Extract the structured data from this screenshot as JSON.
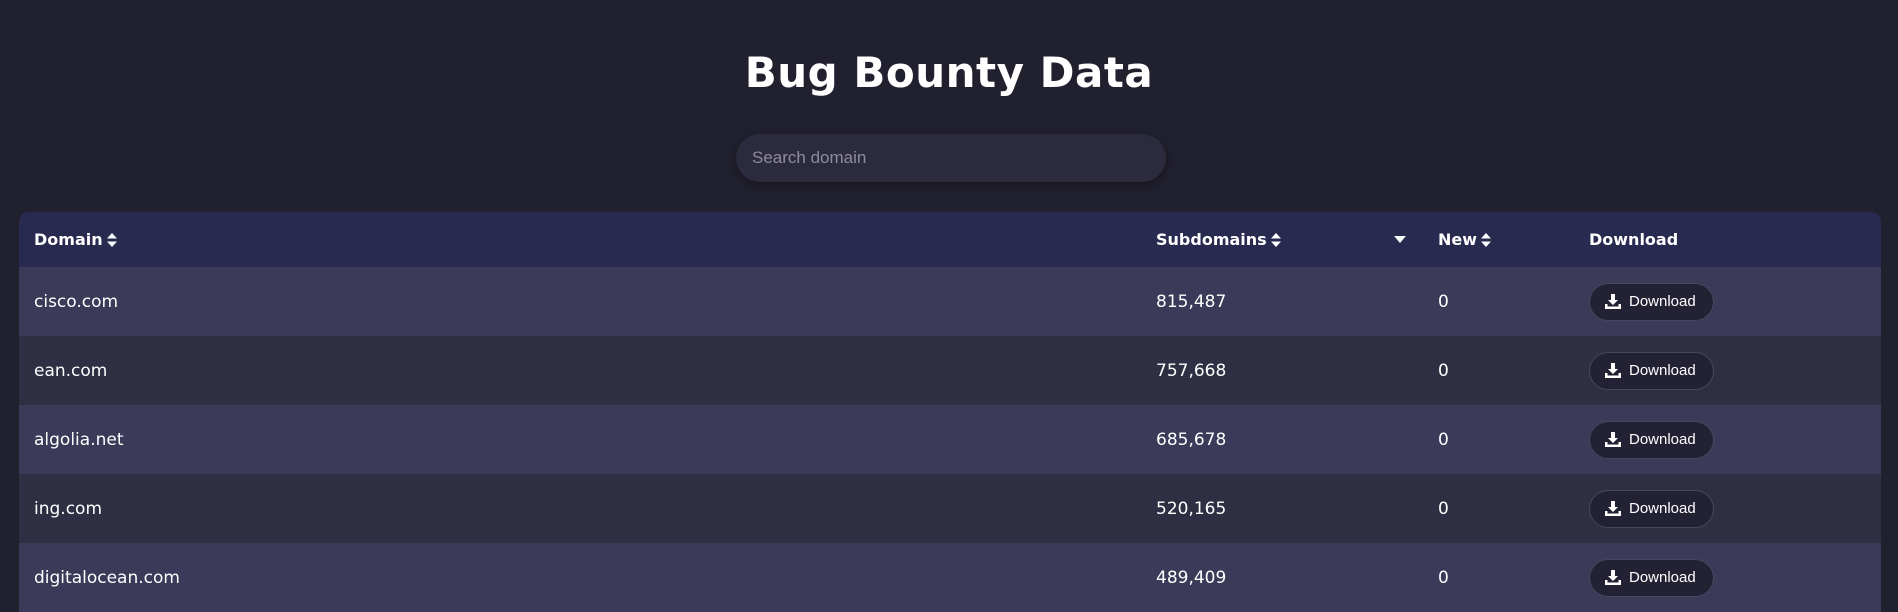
{
  "page": {
    "title": "Bug Bounty Data"
  },
  "search": {
    "placeholder": "Search domain",
    "value": ""
  },
  "table": {
    "headers": {
      "domain": "Domain",
      "subdomains": "Subdomains",
      "new": "New",
      "download": "Download"
    },
    "rows": [
      {
        "domain": "cisco.com",
        "subdomains": "815,487",
        "new": "0",
        "download_label": "Download"
      },
      {
        "domain": "ean.com",
        "subdomains": "757,668",
        "new": "0",
        "download_label": "Download"
      },
      {
        "domain": "algolia.net",
        "subdomains": "685,678",
        "new": "0",
        "download_label": "Download"
      },
      {
        "domain": "ing.com",
        "subdomains": "520,165",
        "new": "0",
        "download_label": "Download"
      },
      {
        "domain": "digitalocean.com",
        "subdomains": "489,409",
        "new": "0",
        "download_label": "Download"
      }
    ]
  },
  "icons": {
    "sort": "sort-updown-icon",
    "filter": "caret-down-icon",
    "download": "download-icon"
  },
  "colors": {
    "background": "#21202e",
    "header_row": "#292a50",
    "row_odd": "#3b3a58",
    "row_even": "#2f2f44",
    "button": "#232234"
  }
}
